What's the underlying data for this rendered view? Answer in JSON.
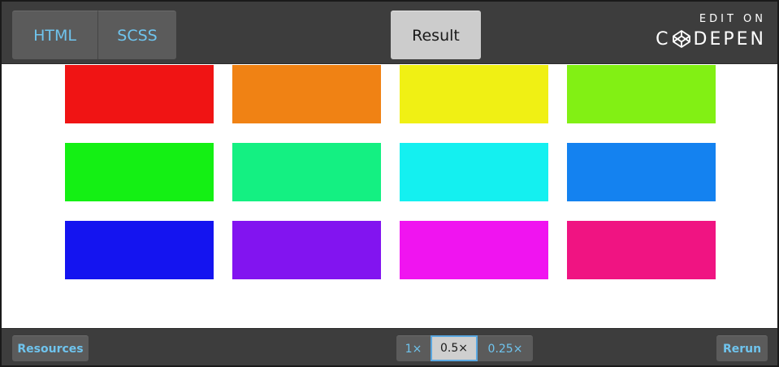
{
  "header": {
    "tabs": [
      {
        "label": "HTML"
      },
      {
        "label": "SCSS"
      }
    ],
    "result_tab": {
      "label": "Result",
      "active": true
    },
    "codepen": {
      "edit_on": "EDIT ON",
      "brand_left": "C",
      "brand_right": "DEPEN",
      "logo_icon": "codepen-logo-icon"
    }
  },
  "result": {
    "swatches": [
      {
        "color": "#f01414"
      },
      {
        "color": "#f08214"
      },
      {
        "color": "#f0f014"
      },
      {
        "color": "#82f014"
      },
      {
        "color": "#14f014"
      },
      {
        "color": "#14f082"
      },
      {
        "color": "#14f0f0"
      },
      {
        "color": "#1482f0"
      },
      {
        "color": "#1414f0"
      },
      {
        "color": "#8214f0"
      },
      {
        "color": "#f014f0"
      },
      {
        "color": "#f01482"
      }
    ]
  },
  "footer": {
    "resources_label": "Resources",
    "zoom_options": [
      {
        "label": "1×",
        "active": false
      },
      {
        "label": "0.5×",
        "active": true
      },
      {
        "label": "0.25×",
        "active": false
      }
    ],
    "rerun_label": "Rerun"
  },
  "colors": {
    "bar_bg": "#3d3d3d",
    "tab_bg": "#5b5b5b",
    "tab_text": "#6fc4ee",
    "active_tab_bg": "#cccccc",
    "active_zoom_border": "#5aa7e0"
  }
}
